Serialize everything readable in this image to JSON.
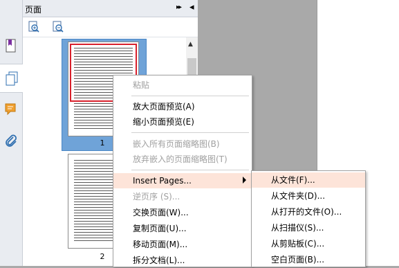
{
  "panel": {
    "title": "页面",
    "collapse_glyph": "▸▸",
    "close_glyph": "◂"
  },
  "sidebar_icons": [
    "bookmark-icon",
    "pages-icon",
    "comment-icon",
    "attachment-icon"
  ],
  "thumbnails": [
    {
      "label": "1",
      "selected": true
    },
    {
      "label": "2",
      "selected": false
    }
  ],
  "context_menu": {
    "items": [
      {
        "label": "粘贴",
        "enabled": false
      },
      {
        "label": "放大页面预览(A)",
        "enabled": true
      },
      {
        "label": "缩小页面预览(E)",
        "enabled": true
      },
      {
        "label": "嵌入所有页面缩略图(B)",
        "enabled": false
      },
      {
        "label": "放弃嵌入的页面缩略图(T)",
        "enabled": false
      },
      {
        "label": "Insert Pages...",
        "enabled": true,
        "highlighted": true,
        "has_submenu": true
      },
      {
        "label": "逆页序 (S)...",
        "enabled": false
      },
      {
        "label": "交换页面(W)...",
        "enabled": true
      },
      {
        "label": "复制页面(U)...",
        "enabled": true
      },
      {
        "label": "移动页面(M)...",
        "enabled": true
      },
      {
        "label": "拆分文档(L)...",
        "enabled": true
      }
    ]
  },
  "insert_submenu": {
    "items": [
      {
        "label": "从文件(F)...",
        "highlighted": true
      },
      {
        "label": "从文件夹(D)..."
      },
      {
        "label": "从打开的文件(O)..."
      },
      {
        "label": "从扫描仪(S)..."
      },
      {
        "label": "从剪贴板(C)..."
      },
      {
        "label": "空白页面(B)..."
      }
    ]
  },
  "colors": {
    "selection": "#6fa3d8",
    "menu_highlight": "#fde4d9",
    "red_view_box": "#d8202c"
  }
}
